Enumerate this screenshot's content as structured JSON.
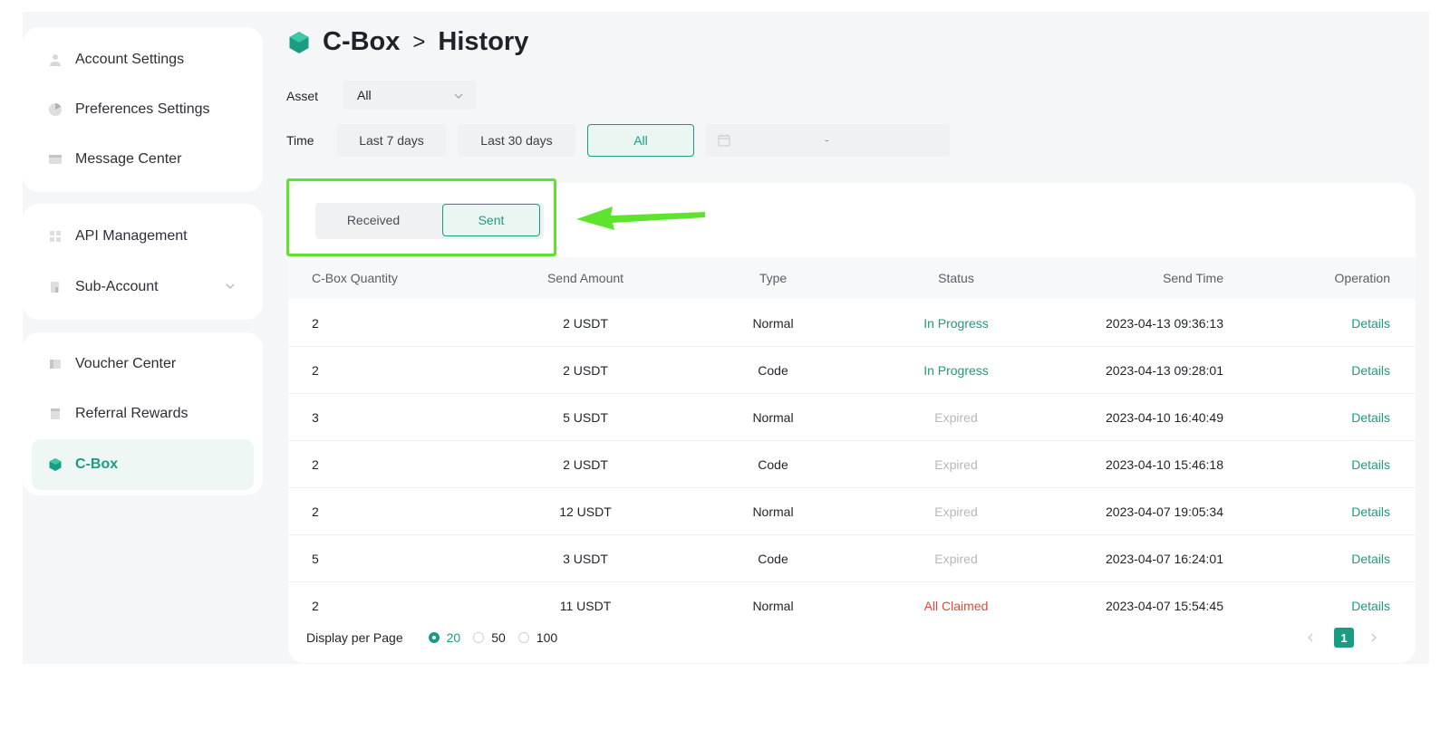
{
  "sidebar": {
    "group1": [
      {
        "label": "Account Settings",
        "icon": "user-icon"
      },
      {
        "label": "Preferences Settings",
        "icon": "pie-chart-icon"
      },
      {
        "label": "Message Center",
        "icon": "message-icon"
      }
    ],
    "group2": [
      {
        "label": "API Management",
        "icon": "api-icon"
      },
      {
        "label": "Sub-Account",
        "icon": "sub-account-icon"
      }
    ],
    "group3": [
      {
        "label": "Voucher Center",
        "icon": "voucher-icon"
      },
      {
        "label": "Referral Rewards",
        "icon": "referral-icon"
      },
      {
        "label": "C-Box",
        "icon": "cbox-icon",
        "active": true
      }
    ]
  },
  "header": {
    "title_parent": "C-Box",
    "separator": ">",
    "title_current": "History"
  },
  "filters": {
    "asset_label": "Asset",
    "asset_value": "All",
    "time_label": "Time",
    "time_options": [
      "Last 7 days",
      "Last 30 days",
      "All"
    ],
    "time_selected": "All",
    "date_separator": "-"
  },
  "tabs": {
    "received": "Received",
    "sent": "Sent",
    "selected": "Sent"
  },
  "table": {
    "columns": [
      "C-Box Quantity",
      "Send Amount",
      "Type",
      "Status",
      "Send Time",
      "Operation"
    ],
    "rows": [
      {
        "quantity": "2",
        "amount": "2 USDT",
        "type": "Normal",
        "status": "In Progress",
        "time": "2023-04-13 09:36:13",
        "op": "Details"
      },
      {
        "quantity": "2",
        "amount": "2 USDT",
        "type": "Code",
        "status": "In Progress",
        "time": "2023-04-13 09:28:01",
        "op": "Details"
      },
      {
        "quantity": "3",
        "amount": "5 USDT",
        "type": "Normal",
        "status": "Expired",
        "time": "2023-04-10 16:40:49",
        "op": "Details"
      },
      {
        "quantity": "2",
        "amount": "2 USDT",
        "type": "Code",
        "status": "Expired",
        "time": "2023-04-10 15:46:18",
        "op": "Details"
      },
      {
        "quantity": "2",
        "amount": "12 USDT",
        "type": "Normal",
        "status": "Expired",
        "time": "2023-04-07 19:05:34",
        "op": "Details"
      },
      {
        "quantity": "5",
        "amount": "3 USDT",
        "type": "Code",
        "status": "Expired",
        "time": "2023-04-07 16:24:01",
        "op": "Details"
      },
      {
        "quantity": "2",
        "amount": "11 USDT",
        "type": "Normal",
        "status": "All Claimed",
        "time": "2023-04-07 15:54:45",
        "op": "Details"
      }
    ]
  },
  "footer": {
    "per_page_label": "Display per Page",
    "per_page_options": [
      "20",
      "50",
      "100"
    ],
    "per_page_selected": "20",
    "current_page": "1"
  },
  "colors": {
    "accent": "#1a9c80",
    "status_in_progress": "#1a9c80",
    "status_expired": "#b5b8bc",
    "status_all_claimed": "#e5483b",
    "annotation": "#5ee32e"
  }
}
